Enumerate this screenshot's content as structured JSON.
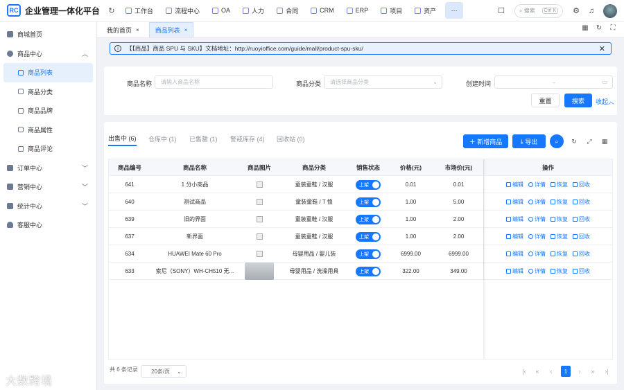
{
  "brand": {
    "logo": "RC",
    "title": "企业管理一体化平台"
  },
  "topmenu": [
    {
      "label": "工作台",
      "icon": "dashboard-icon"
    },
    {
      "label": "流程中心",
      "icon": "workflow-icon"
    },
    {
      "label": "OA",
      "icon": "oa-icon"
    },
    {
      "label": "人力",
      "icon": "user-icon"
    },
    {
      "label": "合同",
      "icon": "contract-icon"
    },
    {
      "label": "CRM",
      "icon": "crm-icon"
    },
    {
      "label": "ERP",
      "icon": "erp-icon"
    },
    {
      "label": "项目",
      "icon": "project-icon"
    },
    {
      "label": "资产",
      "icon": "asset-icon"
    }
  ],
  "top_search": {
    "placeholder": "搜索",
    "shortcut": "Ctrl K"
  },
  "sidebar": {
    "items": [
      {
        "label": "商城首页",
        "icon": "home-icon"
      },
      {
        "label": "商品中心",
        "icon": "goods-icon",
        "expanded": true
      },
      {
        "label": "商品列表",
        "icon": "list-icon",
        "active": true
      },
      {
        "label": "商品分类",
        "icon": "category-icon"
      },
      {
        "label": "商品品牌",
        "icon": "brand-icon"
      },
      {
        "label": "商品属性",
        "icon": "attribute-icon"
      },
      {
        "label": "商品评论",
        "icon": "comment-icon"
      },
      {
        "label": "订单中心",
        "icon": "order-icon"
      },
      {
        "label": "营销中心",
        "icon": "marketing-icon"
      },
      {
        "label": "统计中心",
        "icon": "statistics-icon"
      },
      {
        "label": "客服中心",
        "icon": "service-icon"
      }
    ]
  },
  "tabs": [
    {
      "label": "我的首页",
      "close": "×"
    },
    {
      "label": "商品列表",
      "close": "×"
    }
  ],
  "alert": {
    "text": "【【商品】商品 SPU 与 SKU】文档地址：http://ruoyioffice.com/guide/mall/product-spu-sku/",
    "close": "✕"
  },
  "filters": {
    "name_label": "商品名称",
    "name_placeholder": "请输入商品名称",
    "category_label": "商品分类",
    "category_placeholder": "请选择商品分类",
    "time_label": "创建时间",
    "time_sep": "→",
    "reset": "重置",
    "search": "搜索",
    "collapse": "收起"
  },
  "status_tabs": [
    {
      "label": "出售中 (6)"
    },
    {
      "label": "仓库中 (1)"
    },
    {
      "label": "已售罄 (1)"
    },
    {
      "label": "警戒库存 (4)"
    },
    {
      "label": "回收站 (0)"
    }
  ],
  "actions": {
    "add": "＋ 新增商品",
    "export": "导出"
  },
  "table": {
    "headers": [
      "商品编号",
      "商品名称",
      "商品图片",
      "商品分类",
      "销售状态",
      "价格(元)",
      "市场价(元)",
      "操作"
    ],
    "ops": [
      "编辑",
      "详情",
      "恢复",
      "回收"
    ],
    "rows": [
      {
        "id": "641",
        "name": "1 分小商品",
        "category": "童装童鞋 / 汉服",
        "status": "上架",
        "price": "0.01",
        "market": "0.01"
      },
      {
        "id": "640",
        "name": "测试商品",
        "category": "童装童鞋 / T 恤",
        "status": "上架",
        "price": "1.00",
        "market": "5.00"
      },
      {
        "id": "639",
        "name": "旧的界面",
        "category": "童装童鞋 / 汉服",
        "status": "上架",
        "price": "1.00",
        "market": "2.00"
      },
      {
        "id": "637",
        "name": "新界面",
        "category": "童装童鞋 / 汉服",
        "status": "上架",
        "price": "1.00",
        "market": "2.00"
      },
      {
        "id": "634",
        "name": "HUAWEI Mate 60 Pro",
        "category": "母婴用品 / 婴儿装",
        "status": "上架",
        "price": "6999.00",
        "market": "6999.00"
      },
      {
        "id": "633",
        "name": "索尼（SONY）WH-CH510 无...",
        "category": "母婴用品 / 洗澡用具",
        "status": "上架",
        "price": "322.00",
        "market": "349.00"
      }
    ]
  },
  "pagination": {
    "total": "共 6 条记录",
    "page_size": "20条/页",
    "current": "1"
  },
  "watermark": "大数跨境"
}
